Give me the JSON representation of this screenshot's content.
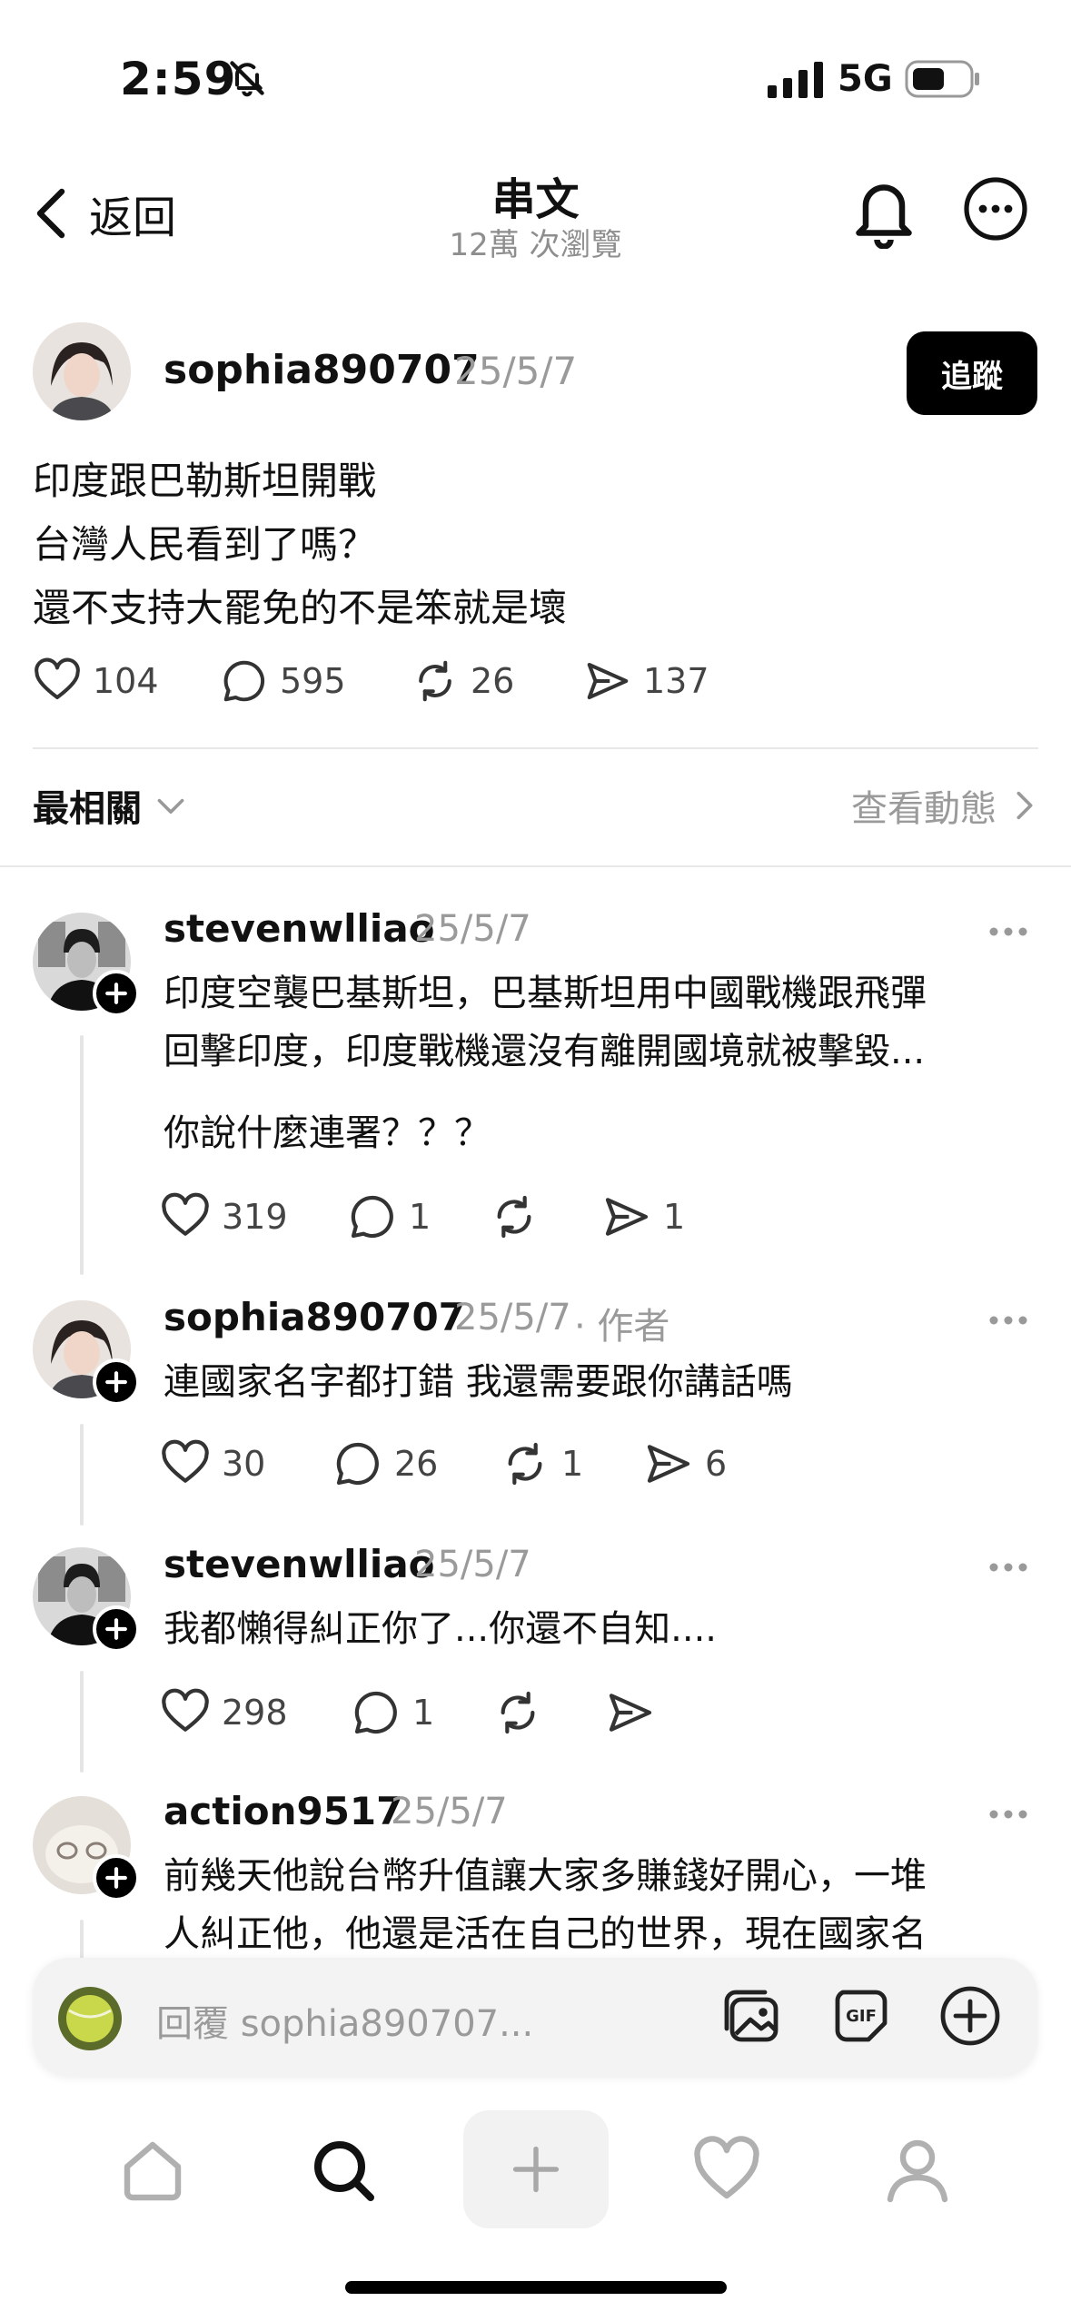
{
  "status_bar": {
    "time": "2:59",
    "network": "5G"
  },
  "header": {
    "back_label": "返回",
    "title": "串文",
    "views": "12萬 次瀏覽"
  },
  "post": {
    "username": "sophia890707",
    "date": "25/5/7",
    "follow_label": "追蹤",
    "lines": [
      "印度跟巴勒斯坦開戰",
      "台灣人民看到了嗎？",
      "還不支持大罷免的不是笨就是壞"
    ],
    "likes": "104",
    "comments": "595",
    "reposts": "26",
    "shares": "137"
  },
  "sort": {
    "label": "最相關",
    "activity_label": "查看動態"
  },
  "replies": [
    {
      "username": "stevenwlliao",
      "date": "25/5/7",
      "lines": [
        "印度空襲巴基斯坦，巴基斯坦用中國戰機跟飛彈",
        "回擊印度，印度戰機還沒有離開國境就被擊毀..."
      ],
      "extra": "你說什麼連署？？？",
      "likes": "319",
      "comments": "1",
      "reposts": "",
      "shares": "1"
    },
    {
      "username": "sophia890707",
      "date": "25/5/7",
      "author_tag": "· 作者",
      "lines": [
        "連國家名字都打錯 我還需要跟你講話嗎"
      ],
      "likes": "30",
      "comments": "26",
      "reposts": "1",
      "shares": "6"
    },
    {
      "username": "stevenwlliao",
      "date": "25/5/7",
      "lines": [
        "我都懶得糾正你了...你還不自知...."
      ],
      "likes": "298",
      "comments": "1",
      "reposts": "",
      "shares": ""
    },
    {
      "username": "action9517",
      "date": "25/5/7",
      "lines": [
        "前幾天他說台幣升值讓大家多賺錢好開心，一堆",
        "人糾正他，他還是活在自己的世界，現在國家名"
      ]
    }
  ],
  "composer": {
    "placeholder": "回覆 sophia890707..."
  },
  "icons": {
    "like": "heart-icon",
    "comment": "speech-bubble-icon",
    "repost": "repost-icon",
    "share": "send-icon",
    "tabs": [
      "home-icon",
      "search-icon",
      "plus-icon",
      "heart-icon",
      "profile-icon"
    ]
  },
  "colors": {
    "muted": "#9a9a9a",
    "follow_bg": "#000000"
  }
}
